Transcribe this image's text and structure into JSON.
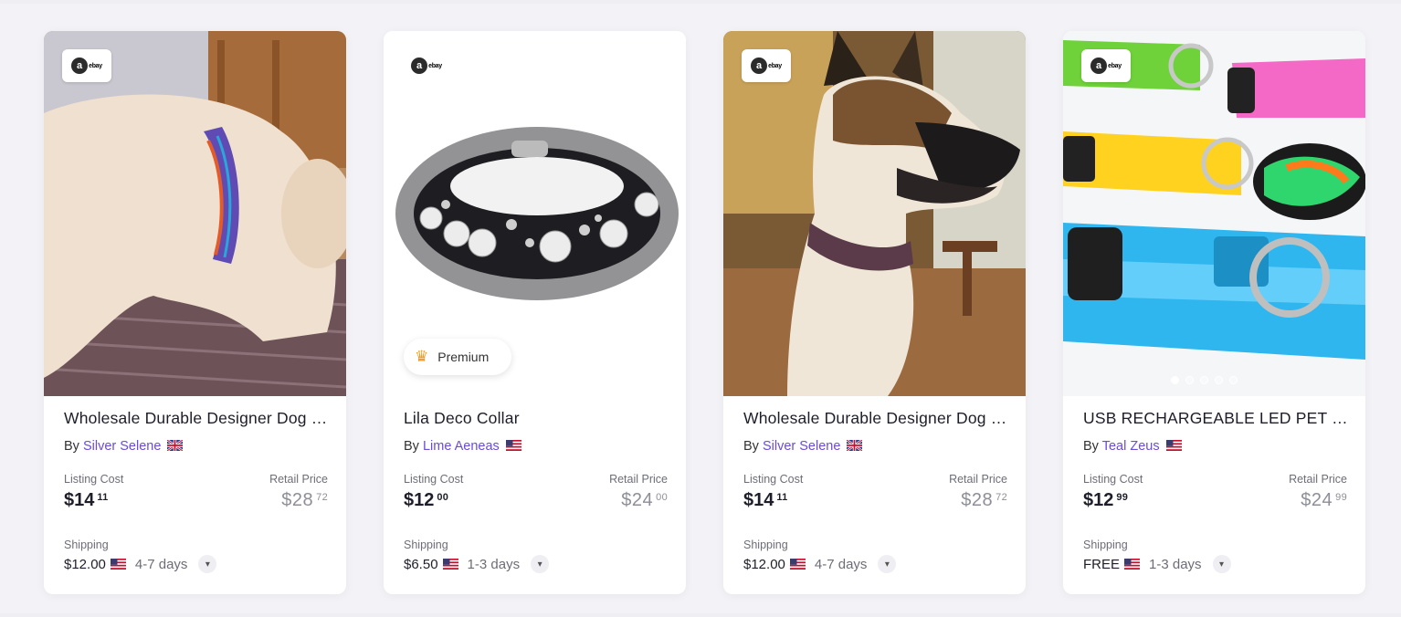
{
  "source_badge": {
    "letter": "a",
    "text": "ebay"
  },
  "premium_label": "Premium",
  "listing_cost_label": "Listing Cost",
  "retail_price_label": "Retail Price",
  "shipping_label": "Shipping",
  "by_label": "By",
  "products": [
    {
      "title": "Wholesale Durable Designer Dog Collar",
      "seller": "Silver Selene",
      "seller_flag": "gb-flag-icon",
      "listing_cost_whole": "$14",
      "listing_cost_cents": "11",
      "retail_whole": "$28",
      "retail_cents": "72",
      "shipping_cost": "$12.00",
      "shipping_flag": "us-flag-icon",
      "shipping_days": "4-7 days",
      "premium": false
    },
    {
      "title": "Lila Deco Collar",
      "seller": "Lime Aeneas",
      "seller_flag": "us-flag-icon",
      "listing_cost_whole": "$12",
      "listing_cost_cents": "00",
      "retail_whole": "$24",
      "retail_cents": "00",
      "shipping_cost": "$6.50",
      "shipping_flag": "us-flag-icon",
      "shipping_days": "1-3 days",
      "premium": true
    },
    {
      "title": "Wholesale Durable Designer Dog Collar",
      "seller": "Silver Selene",
      "seller_flag": "gb-flag-icon",
      "listing_cost_whole": "$14",
      "listing_cost_cents": "11",
      "retail_whole": "$28",
      "retail_cents": "72",
      "shipping_cost": "$12.00",
      "shipping_flag": "us-flag-icon",
      "shipping_days": "4-7 days",
      "premium": false
    },
    {
      "title": "USB RECHARGEABLE LED PET COLLAR",
      "seller": "Teal Zeus",
      "seller_flag": "us-flag-icon",
      "listing_cost_whole": "$12",
      "listing_cost_cents": "99",
      "retail_whole": "$24",
      "retail_cents": "99",
      "shipping_cost": "FREE",
      "shipping_flag": "us-flag-icon",
      "shipping_days": "1-3 days",
      "premium": false,
      "carousel_dots": 5,
      "carousel_active": 1
    }
  ],
  "colors": {
    "seller_link": "#6a4bdb",
    "premium_crown": "#f39a1e"
  }
}
